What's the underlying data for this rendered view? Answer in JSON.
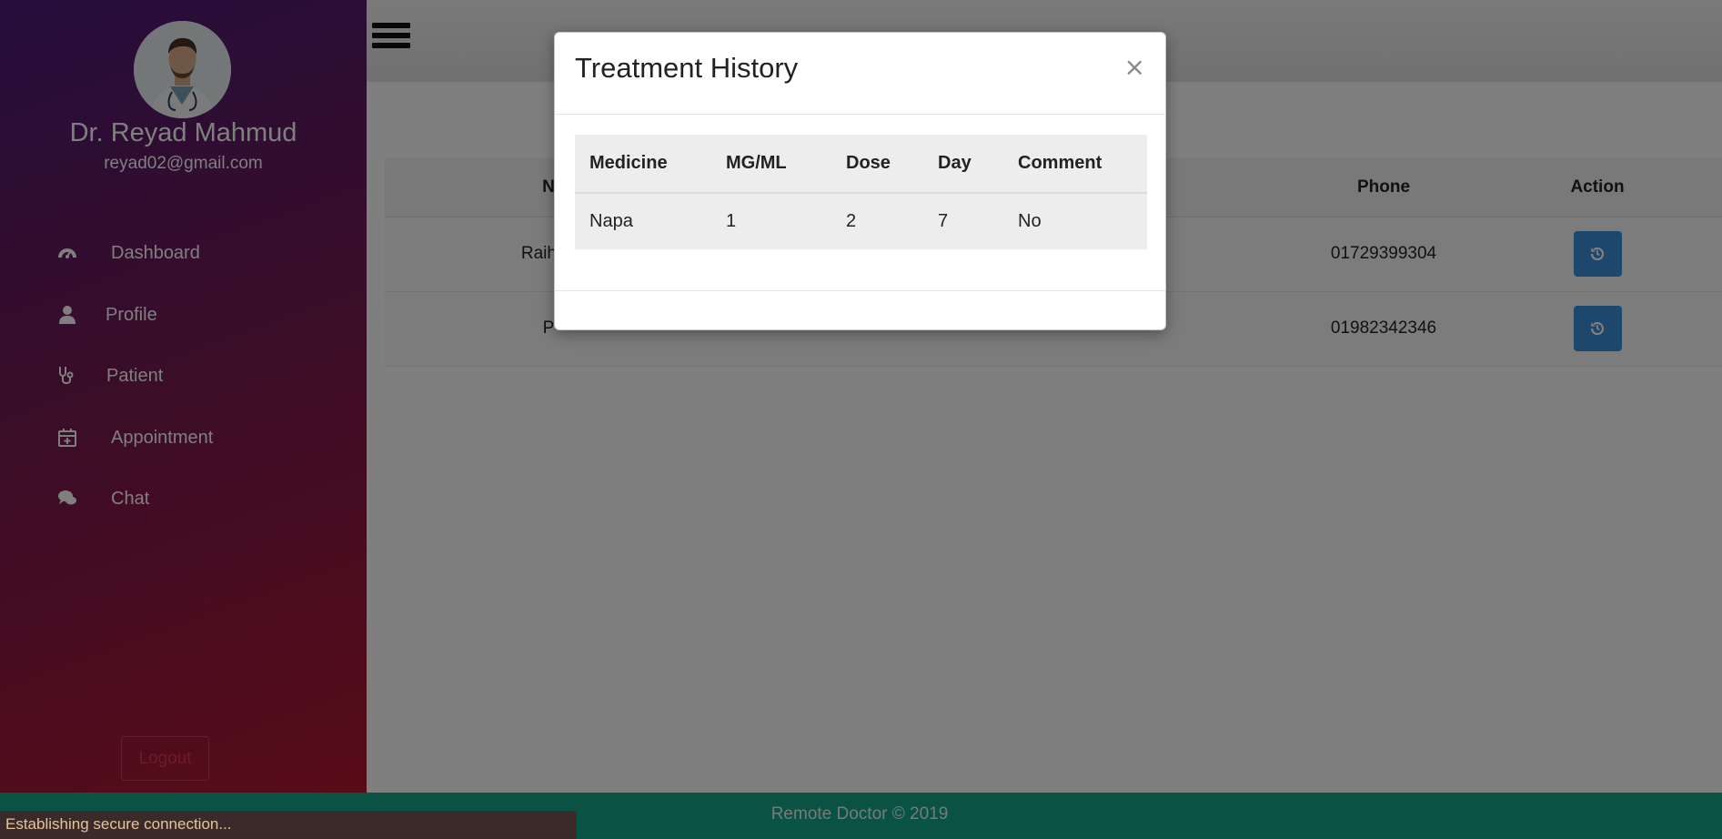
{
  "sidebar": {
    "doctor_name": "Dr. Reyad Mahmud",
    "doctor_email": "reyad02@gmail.com",
    "items": [
      {
        "label": "Dashboard",
        "icon": "dashboard-icon"
      },
      {
        "label": "Profile",
        "icon": "user-icon"
      },
      {
        "label": "Patient",
        "icon": "stethoscope-icon"
      },
      {
        "label": "Appointment",
        "icon": "calendar-plus-icon"
      },
      {
        "label": "Chat",
        "icon": "chat-icon"
      }
    ],
    "logout_label": "Logout"
  },
  "patients": {
    "headers": [
      "N",
      "Phone",
      "Action"
    ],
    "rows": [
      {
        "name": "Raihan",
        "phone": "01729399304"
      },
      {
        "name": "P",
        "phone": "01982342346"
      }
    ]
  },
  "modal": {
    "title": "Treatment History",
    "close": "×",
    "headers": [
      "Medicine",
      "MG/ML",
      "Dose",
      "Day",
      "Comment"
    ],
    "rows": [
      {
        "medicine": "Napa",
        "mgml": "1",
        "dose": "2",
        "day": "7",
        "comment": "No"
      }
    ]
  },
  "footer": {
    "text": "Remote Doctor © 2019"
  },
  "status": {
    "text": "Establishing secure connection..."
  },
  "colors": {
    "action_button": "#3c8fdb",
    "footer": "#15a587",
    "logout": "#e0344d"
  }
}
